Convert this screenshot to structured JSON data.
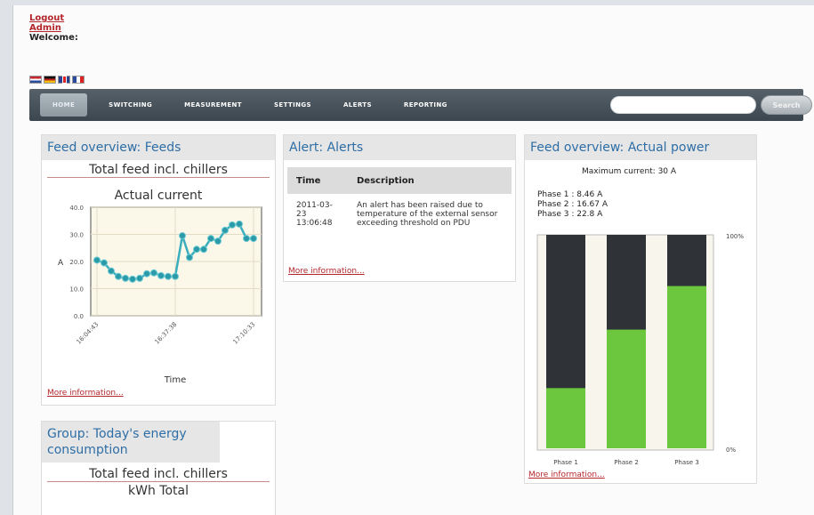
{
  "top_links": {
    "logout": "Logout",
    "admin": "Admin",
    "welcome": "Welcome:"
  },
  "nav": {
    "items": [
      "HOME",
      "SWITCHING",
      "MEASUREMENT",
      "SETTINGS",
      "ALERTS",
      "REPORTING"
    ],
    "active": "HOME",
    "search_button": "Search",
    "search_value": ""
  },
  "feeds_panel": {
    "title": "Feed overview: Feeds",
    "subtitle": "Total feed incl. chillers",
    "more": "More information..."
  },
  "alerts_panel": {
    "title": "Alert: Alerts",
    "columns": [
      "Time",
      "Description"
    ],
    "rows": [
      {
        "time": "2011-03-23 13:06:48",
        "description": "An alert has been raised due to temperature of the external sensor exceeding threshold on PDU"
      }
    ],
    "more": "More information..."
  },
  "power_panel": {
    "title": "Feed overview: Actual power",
    "max_current": "Maximum current: 30 A",
    "phases": [
      "Phase 1 : 8.46 A",
      "Phase 2 : 16.67 A",
      "Phase 3 : 22.8 A"
    ],
    "more": "More information..."
  },
  "energy_panel": {
    "title": "Group: Today's energy consumption",
    "subtitle": "Total feed incl. chillers",
    "chart_title": "kWh Total"
  },
  "chart_data": [
    {
      "type": "line",
      "title": "Actual current",
      "xlabel": "Time",
      "ylabel": "A",
      "ylim": [
        0,
        40
      ],
      "yticks": [
        "0.0",
        "10.0",
        "20.0",
        "30.0",
        "40.0"
      ],
      "xticks": [
        "16:04:43",
        "16:37:38",
        "17:10:33"
      ],
      "y": [
        20.5,
        19.5,
        16.5,
        14.5,
        13.8,
        13.5,
        13.8,
        15.5,
        15.8,
        14.8,
        14.5,
        14.5,
        29.5,
        21.5,
        24.5,
        24.5,
        28.5,
        27.5,
        31.5,
        33.5,
        33.8,
        28.5,
        28.5
      ],
      "colors": {
        "line": "#3aaebc",
        "point": "#2b9aa8",
        "plot_bg": "#fbf8ea"
      },
      "grid": true
    },
    {
      "type": "bar",
      "title": "",
      "categories": [
        "Phase 1",
        "Phase 2",
        "Phase 3"
      ],
      "values": [
        28.2,
        55.6,
        76.0
      ],
      "ylim": [
        0,
        100
      ],
      "ylabels": [
        "100%",
        "0%"
      ],
      "colors": {
        "fill": "#6cc63e",
        "remaining": "#2f3236"
      }
    }
  ]
}
